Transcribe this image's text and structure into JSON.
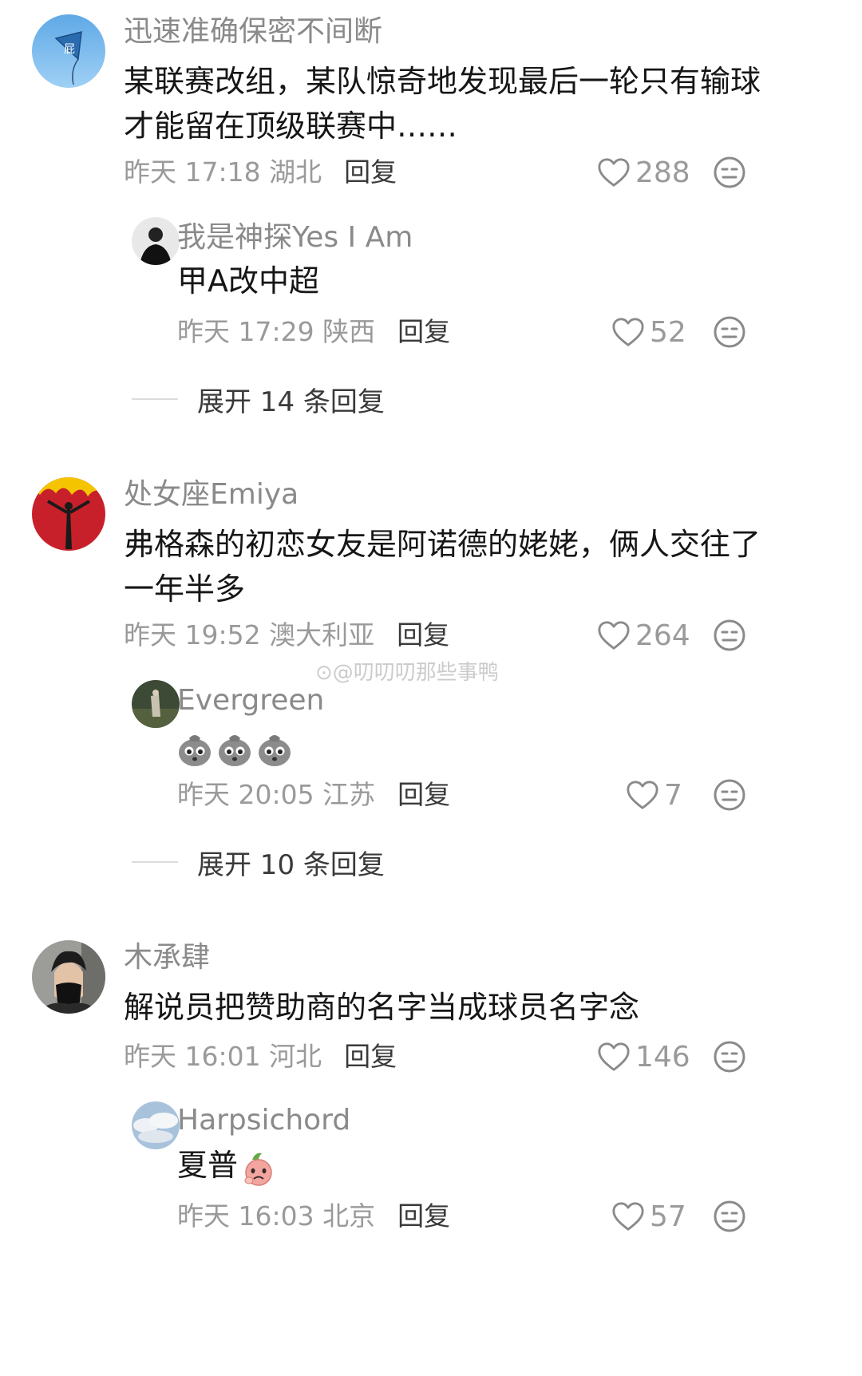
{
  "comments": [
    {
      "user": "迅速准确保密不间断",
      "text": "某联赛改组，某队惊奇地发现最后一轮只有输球才能留在顶级联赛中……",
      "time": "昨天 17:18 湖北",
      "reply_label": "回复",
      "likes": "288",
      "reply": {
        "user": "我是神探Yes I Am",
        "text": "甲A改中超",
        "time": "昨天 17:29 陕西",
        "reply_label": "回复",
        "likes": "52"
      },
      "expand": "展开 14 条回复"
    },
    {
      "user": "处女座Emiya",
      "text": "弗格森的初恋女友是阿诺德的姥姥，俩人交往了一年半多",
      "time": "昨天 19:52 澳大利亚",
      "reply_label": "回复",
      "likes": "264",
      "reply": {
        "user": "Evergreen",
        "text": "",
        "time": "昨天 20:05 江苏",
        "reply_label": "回复",
        "likes": "7"
      },
      "expand": "展开 10 条回复"
    },
    {
      "user": "木承肆",
      "text": "解说员把赞助商的名字当成球员名字念",
      "time": "昨天 16:01 河北",
      "reply_label": "回复",
      "likes": "146",
      "reply": {
        "user": "Harpsichord",
        "text": "夏普",
        "time": "昨天 16:03 北京",
        "reply_label": "回复",
        "likes": "57"
      }
    }
  ],
  "watermark": "@叨叨叨那些事鸭",
  "icons": {
    "like": "heart-outline-icon",
    "dislike": "neutral-face-icon",
    "emoji": "crying-bag-emoji",
    "emoji_peach": "peach-emoji"
  }
}
